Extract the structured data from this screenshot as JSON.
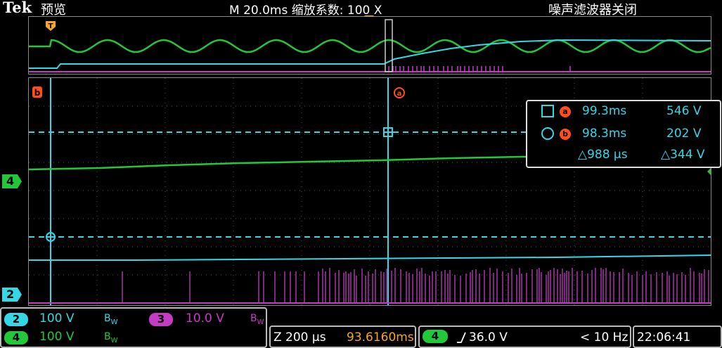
{
  "header": {
    "brand": "Tek",
    "mode": "预览",
    "timebase_zoom": "M 20.0ms  缩放系数: 100 X",
    "noise_filter": "噪声滤波器关闭"
  },
  "markers": {
    "ch4": "4",
    "ch2": "2",
    "cursor_a": "a",
    "cursor_b": "b",
    "trigger": "T"
  },
  "readout": {
    "row_a_time": "99.3ms",
    "row_a_volt": "546 V",
    "row_b_time": "98.3ms",
    "row_b_volt": "202 V",
    "delta_time": "△988 μs",
    "delta_volt": "△344 V"
  },
  "channels": [
    {
      "badge": "2",
      "scale": "100 V",
      "bw": "B",
      "bw_sub": "W",
      "color": "#35d7e6"
    },
    {
      "badge": "4",
      "scale": "100 V",
      "bw": "B",
      "bw_sub": "W",
      "color": "#23c83a"
    },
    {
      "badge": "3",
      "scale": "10.0 V",
      "bw": "B",
      "bw_sub": "W",
      "color": "#c43cc4"
    }
  ],
  "zoom_panel": {
    "zoom_scale": "Z 200 μs",
    "position": "93.6160ms"
  },
  "trigger_panel": {
    "source": "4",
    "level": "36.0 V",
    "frequency": "< 10 Hz"
  },
  "clock": "22:06:41",
  "colors": {
    "ch2": "#35d7e6",
    "ch3": "#c43cc4",
    "ch4": "#23c83a",
    "cursor_badge": "#ff4e1a",
    "trigger_marker": "#f5a623"
  }
}
